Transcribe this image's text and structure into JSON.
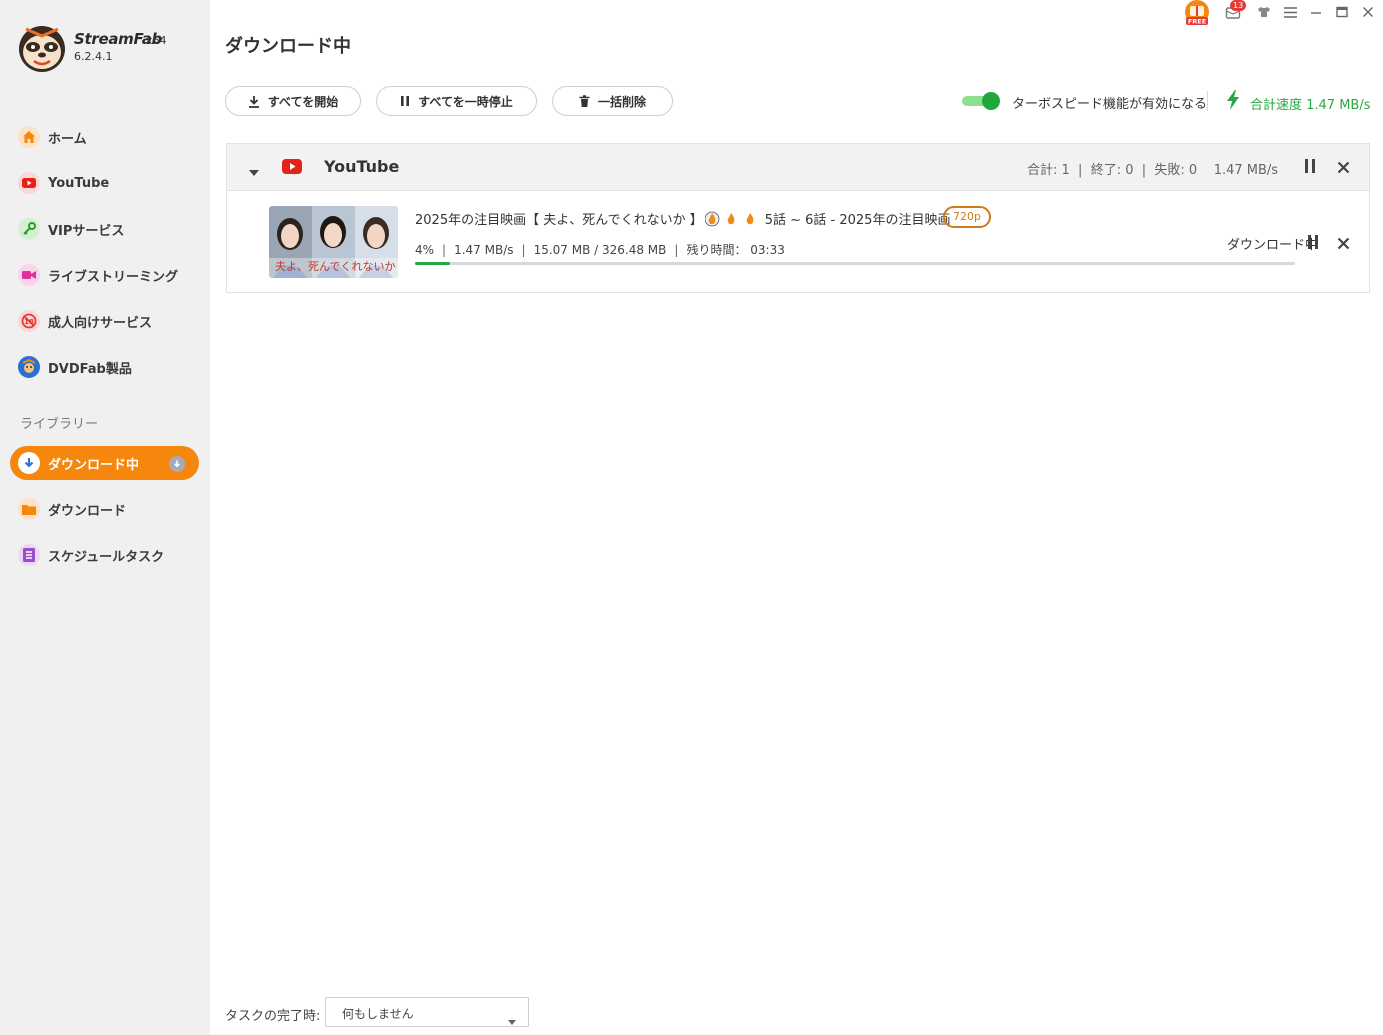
{
  "app": {
    "name": "StreamFab",
    "arch": "x64",
    "version": "6.2.4.1"
  },
  "window": {
    "notification_count": "13",
    "free_badge": "FREE"
  },
  "sidebar": {
    "items": [
      {
        "label": "ホーム",
        "icon": "home-icon"
      },
      {
        "label": "YouTube",
        "icon": "youtube-icon"
      },
      {
        "label": "VIPサービス",
        "icon": "key-icon"
      },
      {
        "label": "ライブストリーミング",
        "icon": "camera-icon"
      },
      {
        "label": "成人向けサービス",
        "icon": "adult-icon"
      },
      {
        "label": "DVDFab製品",
        "icon": "dvdfab-icon"
      }
    ],
    "library_label": "ライブラリー",
    "library_items": [
      {
        "label": "ダウンロード中",
        "icon": "download-arrow-icon",
        "active": true
      },
      {
        "label": "ダウンロード",
        "icon": "folder-icon"
      },
      {
        "label": "スケジュールタスク",
        "icon": "schedule-icon"
      }
    ]
  },
  "main": {
    "title": "ダウンロード中",
    "toolbar": {
      "start_all": "すべてを開始",
      "pause_all": "すべてを一時停止",
      "delete_all": "一括削除"
    },
    "turbo": {
      "label": "ターボスピード機能が有効になる",
      "enabled": true
    },
    "total_speed": "合計速度 1.47 MB/s"
  },
  "group": {
    "name": "YouTube",
    "stats": "合計: 1  |  終了: 0  |  失敗: 0    1.47 MB/s"
  },
  "task": {
    "thumbnail_caption": "夫よ、死んでくれないか",
    "title_prefix": "2025年の注目映画【 夫よ、死んでくれないか 】",
    "title_suffix": "5話 ~ 6話 - 2025年の注目映画",
    "resolution": "720p",
    "progress_text": "4%",
    "progress_value": 4,
    "speed": "1.47 MB/s",
    "size": "15.07 MB / 326.48 MB",
    "remaining": "残り時間： 03:33",
    "status": "ダウンロード中"
  },
  "footer": {
    "label": "タスクの完了時:",
    "select_value": "何もしません"
  },
  "colors": {
    "accent": "#f5870f",
    "green": "#28a745",
    "youtube_red": "#e62117"
  }
}
